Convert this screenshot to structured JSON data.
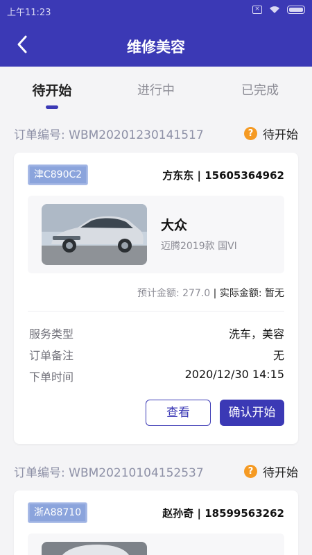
{
  "status_bar": {
    "time": "上午11:23"
  },
  "header": {
    "title": "维修美容"
  },
  "tabs": [
    {
      "label": "待开始",
      "active": true
    },
    {
      "label": "进行中",
      "active": false
    },
    {
      "label": "已完成",
      "active": false
    }
  ],
  "colors": {
    "primary": "#3b39b5",
    "status_icon": "#f59a23",
    "plate_bg": "#8ba4dc"
  },
  "orders": [
    {
      "order_no": "订单编号: WBM20201230141517",
      "status": "待开始",
      "plate": "津C890C2",
      "customer": "方东东 | 15605364962",
      "car_brand": "大众",
      "car_model": "迈腾2019款 国VI",
      "estimated_amount": "预计金额: 277.0",
      "actual_amount": "实际金额: 暂无",
      "service_type_label": "服务类型",
      "service_type": "洗车，美容",
      "note_label": "订单备注",
      "note": "无",
      "time_label": "下单时间",
      "order_time": "2020/12/30 14:15",
      "view_button": "查看",
      "confirm_button": "确认开始"
    },
    {
      "order_no": "订单编号: WBM20210104152537",
      "status": "待开始",
      "plate": "浙A88710",
      "customer": "赵孙奇 | 18599563262"
    }
  ]
}
